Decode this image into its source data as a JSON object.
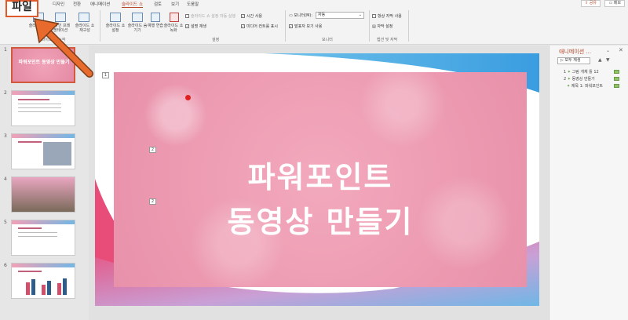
{
  "tabs": [
    {
      "label": "디자인",
      "active": false
    },
    {
      "label": "전환",
      "active": false
    },
    {
      "label": "애니메이션",
      "active": false
    },
    {
      "label": "슬라이드 쇼",
      "active": true
    },
    {
      "label": "검토",
      "active": false
    },
    {
      "label": "보기",
      "active": false
    },
    {
      "label": "도움말",
      "active": false
    }
  ],
  "share_label": "공유",
  "memo_label": "메모",
  "file_tab": "파일",
  "ribbon": {
    "b1": "슬라이드 쇼",
    "b2": "온라인 프레젠테이션",
    "b3": "슬라이드 쇼 재구성",
    "b4": "슬라이드 쇼 설정",
    "b5": "슬라이드 숨기기",
    "b6": "예행 연습",
    "b7": "슬라이드 쇼 녹화",
    "c_narr": "슬라이드 쇼 설정 자동 실행",
    "c_narr_time": "설명 재생",
    "c_timing": "시간 사용",
    "c_media": "미디어 컨트롤 표시",
    "monitor_label": "모니터(M):",
    "monitor_value": "자동",
    "presenter": "발표자 보기 사용",
    "subtitle1": "항상 자막 사용",
    "subtitle2": "자막 설정",
    "group_setup": "설정",
    "group_monitor": "모니터",
    "group_caption": "캡션 및 자막",
    "group_start": "슬라이드 쇼 시작"
  },
  "thumbnails": [
    {
      "num": "1",
      "text": "파워포인트 동영상 만들기"
    },
    {
      "num": "2",
      "text": ""
    },
    {
      "num": "3",
      "text": ""
    },
    {
      "num": "4",
      "text": ""
    },
    {
      "num": "5",
      "text": ""
    },
    {
      "num": "6",
      "text": ""
    }
  ],
  "slide": {
    "title_line1": "파워포인트",
    "title_line2": "동영상 만들기",
    "slot1": "1",
    "slot2": "2",
    "slot3": "2"
  },
  "anim_pane": {
    "title": "애니메이션 ...",
    "play_btn": "모두 재생",
    "items": [
      {
        "num": "1",
        "label": "그림 개체 틀 12"
      },
      {
        "num": "2",
        "label": "동영상 만들기"
      },
      {
        "num": "",
        "label": "제목 1: 파워포인트"
      }
    ]
  }
}
